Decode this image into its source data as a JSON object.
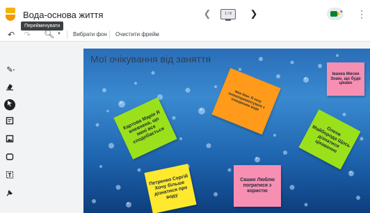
{
  "header": {
    "doc_title": "Вода-основа життя",
    "rename_tooltip": "Перейменувати",
    "frame_thumb_label": "1 / 8",
    "icons": [
      "jamboard-logo",
      "chevron-left-icon",
      "frame-thumbnail",
      "chevron-right-icon",
      "meet-icon",
      "more-vert-icon"
    ]
  },
  "toolbar": {
    "undo_icon": "undo-icon",
    "redo_icon": "redo-icon",
    "zoom_icon": "zoom-in-icon",
    "set_background": "Вибрати фон",
    "clear_frame": "Очистити фрейм"
  },
  "sidebar": {
    "tools": [
      "pen-icon",
      "eraser-icon",
      "select-icon",
      "sticky-note-icon",
      "image-icon",
      "shape-icon",
      "text-box-icon",
      "laser-icon"
    ],
    "selected": "select-icon"
  },
  "canvas": {
    "title": "Мої очікування від заняття",
    "background": "water-drops",
    "notes": [
      {
        "text": "Картова Марія Я впевнена, що мені все сподобається",
        "color": "#9be11b"
      },
      {
        "text": "Іван Іван. Я хочу поекспериментувати з очищенням води",
        "color": "#ff9a1a"
      },
      {
        "text": "Іванка Мисик Знаю, що буде цікаво",
        "color": "#f78fb3"
      },
      {
        "text": "Олена Майборода Щось дізнатися цікавенне",
        "color": "#9be11b"
      },
      {
        "text": "Петренко Сергій Хочу більше дізнатися про воду",
        "color": "#ffe92e"
      },
      {
        "text": "Сашко Люблю погратися з користю",
        "color": "#f78fb3"
      }
    ]
  }
}
